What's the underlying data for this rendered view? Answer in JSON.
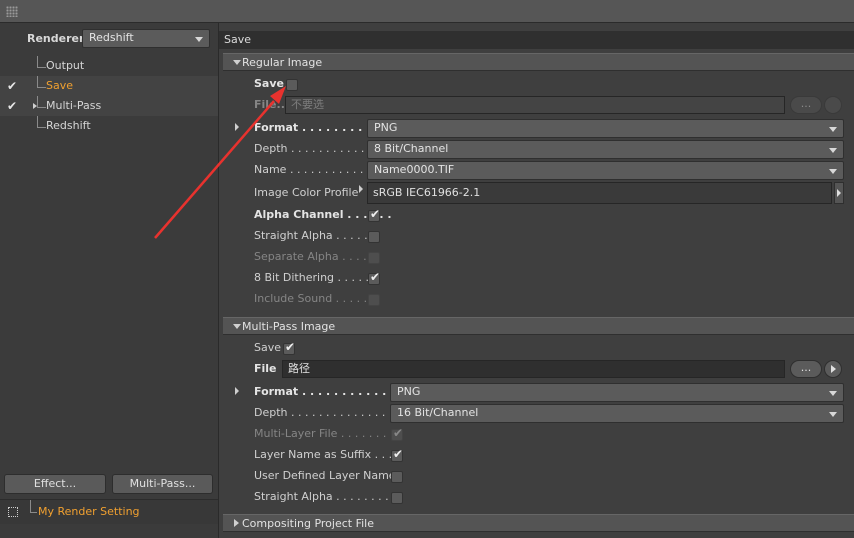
{
  "left_panel": {
    "renderer": {
      "label": "Renderer",
      "value": "Redshift"
    },
    "tree": [
      {
        "label": "Output",
        "checked": false,
        "active": false,
        "expandable": false
      },
      {
        "label": "Save",
        "checked": true,
        "active": true,
        "expandable": false
      },
      {
        "label": "Multi-Pass",
        "checked": true,
        "active": false,
        "expandable": true
      },
      {
        "label": "Redshift",
        "checked": false,
        "active": false,
        "expandable": false
      }
    ],
    "effect_button": "Effect...",
    "multipass_button": "Multi-Pass...",
    "render_setting": "My Render Setting"
  },
  "right_panel": {
    "title": "Save",
    "regular_image": {
      "header": "Regular Image",
      "save_label": "Save",
      "save_checked": false,
      "file_label": "File...",
      "file_placeholder": "不要选",
      "browse_label": "...",
      "format_label": "Format . . . . . . . . . . . .",
      "format_value": "PNG",
      "depth_label": "Depth . . . . . . . . . . . . . .",
      "depth_value": "8 Bit/Channel",
      "name_label": "Name . . . . . . . . . . . . . .",
      "name_value": "Name0000.TIF",
      "color_profile_label": "Image Color Profile",
      "color_profile_value": "sRGB IEC61966-2.1",
      "alpha_channel_label": "Alpha Channel . . . . . .",
      "alpha_channel_checked": true,
      "straight_alpha_label": "Straight Alpha . . . . . .",
      "straight_alpha_checked": false,
      "separate_alpha_label": "Separate Alpha . . . . .",
      "separate_alpha_checked": false,
      "dithering_label": "8 Bit Dithering . . . . . .",
      "dithering_checked": true,
      "include_sound_label": "Include Sound . . . . . .",
      "include_sound_checked": false
    },
    "multipass_image": {
      "header": "Multi-Pass Image",
      "save_label": "Save",
      "save_checked": true,
      "file_label": "File",
      "file_value": "路径",
      "browse_label": "...",
      "format_label": "Format . . . . . . . . . . . . . . .",
      "format_value": "PNG",
      "depth_label": "Depth . . . . . . . . . . . . . . . . .",
      "depth_value": "16 Bit/Channel",
      "multilayer_label": "Multi-Layer File . . . . . . . .",
      "multilayer_checked": true,
      "layer_suffix_label": "Layer Name as Suffix . . .",
      "layer_suffix_checked": true,
      "user_defined_label": "User Defined Layer Name",
      "user_defined_checked": false,
      "straight_alpha_label": "Straight Alpha . . . . . . . . .",
      "straight_alpha_checked": false
    },
    "compositing": {
      "header": "Compositing Project File"
    }
  },
  "annotation": {
    "color": "#e8322e"
  }
}
